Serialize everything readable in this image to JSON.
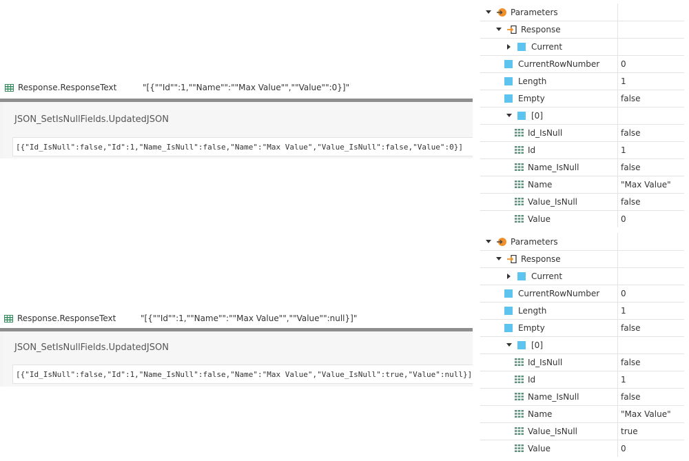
{
  "top": {
    "var_label": "Response.ResponseText",
    "var_value": "\"[{\"\"Id\"\":1,\"\"Name\"\":\"\"Max Value\"\",\"\"Value\"\":0}]\"",
    "expr_title": "JSON_SetIsNullFields.UpdatedJSON",
    "json": "[{\"Id_IsNull\":false,\"Id\":1,\"Name_IsNull\":false,\"Name\":\"Max Value\",\"Value_IsNull\":false,\"Value\":0}]"
  },
  "bottom": {
    "var_label": "Response.ResponseText",
    "var_value": "\"[{\"\"Id\"\":1,\"\"Name\"\":\"\"Max Value\"\",\"\"Value\"\":null}]\"",
    "expr_title": "JSON_SetIsNullFields.UpdatedJSON",
    "json": "[{\"Id_IsNull\":false,\"Id\":1,\"Name_IsNull\":false,\"Name\":\"Max Value\",\"Value_IsNull\":true,\"Value\":null}]"
  },
  "tree1": {
    "parameters": "Parameters",
    "response": "Response",
    "current": "Current",
    "current_row_number": "CurrentRowNumber",
    "current_row_number_value": "0",
    "length": "Length",
    "length_value": "1",
    "empty": "Empty",
    "empty_value": "false",
    "index": "[0]",
    "id_isnull": "Id_IsNull",
    "id_isnull_value": "false",
    "id": "Id",
    "id_value": "1",
    "name_isnull": "Name_IsNull",
    "name_isnull_value": "false",
    "name": "Name",
    "name_value": "\"Max Value\"",
    "value_isnull": "Value_IsNull",
    "value_isnull_value": "false",
    "value": "Value",
    "value_value": "0"
  },
  "tree2": {
    "parameters": "Parameters",
    "response": "Response",
    "current": "Current",
    "current_row_number": "CurrentRowNumber",
    "current_row_number_value": "0",
    "length": "Length",
    "length_value": "1",
    "empty": "Empty",
    "empty_value": "false",
    "index": "[0]",
    "id_isnull": "Id_IsNull",
    "id_isnull_value": "false",
    "id": "Id",
    "id_value": "1",
    "name_isnull": "Name_IsNull",
    "name_isnull_value": "false",
    "name": "Name",
    "name_value": "\"Max Value\"",
    "value_isnull": "Value_IsNull",
    "value_isnull_value": "true",
    "value": "Value",
    "value_value": "0"
  },
  "colors": {
    "accent_blue": "#5cc4ef",
    "param_orange": "#f0902a",
    "divider": "#8e8e8e"
  }
}
